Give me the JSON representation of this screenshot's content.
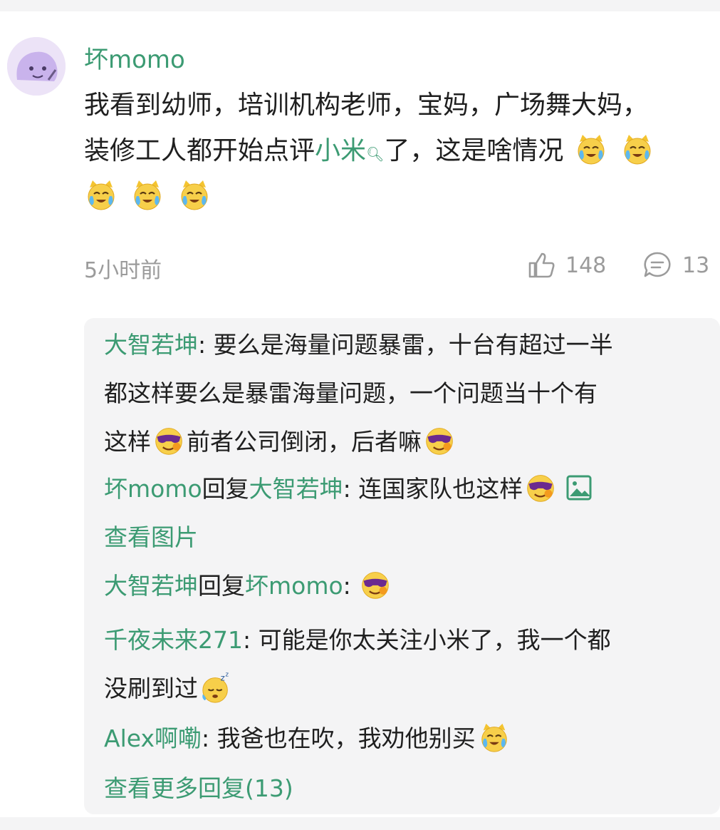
{
  "comment": {
    "username": "坏momo",
    "text_line1": "我看到幼师，培训机构老师，宝妈，广场舞大妈，",
    "text_line2_before": "装修工人都开始点评",
    "text_line2_link": "小米",
    "text_line2_after": "了，这是啥情况",
    "time": "5小时前",
    "likes": "148",
    "reply_count": "13"
  },
  "replies": [
    {
      "name": "大智若坤",
      "sep": ":",
      "line1": " 要么是海量问题暴雷，十台有超过一半",
      "line2": "都这样要么是暴雷海量问题，一个问题当十个有",
      "line3a": "这样",
      "line3b": "前者公司倒闭，后者嘛"
    },
    {
      "name": "坏momo",
      "reply_word": "回复",
      "target": "大智若坤",
      "sep": ":",
      "text": " 连国家队也这样",
      "view_image": "查看图片"
    },
    {
      "name": "大智若坤",
      "reply_word": "回复",
      "target": "坏momo",
      "sep": ":"
    },
    {
      "name": "千夜未来271",
      "sep": ":",
      "line1": " 可能是你太关注小米了，我一个都",
      "line2": "没刷到过"
    },
    {
      "name": "Alex啊嘞",
      "sep": ":",
      "text": " 我爸也在吹，我劝他别买"
    }
  ],
  "more_replies": "查看更多回复(13)",
  "colors": {
    "accent": "#3c9b73",
    "meta": "#9b9b9b",
    "reply_bg": "#f4f4f5"
  },
  "icons": [
    "avatar",
    "laugh-cry-emoji",
    "sunglasses-emoji",
    "sleep-emoji",
    "like-icon",
    "comment-icon",
    "image-icon"
  ]
}
